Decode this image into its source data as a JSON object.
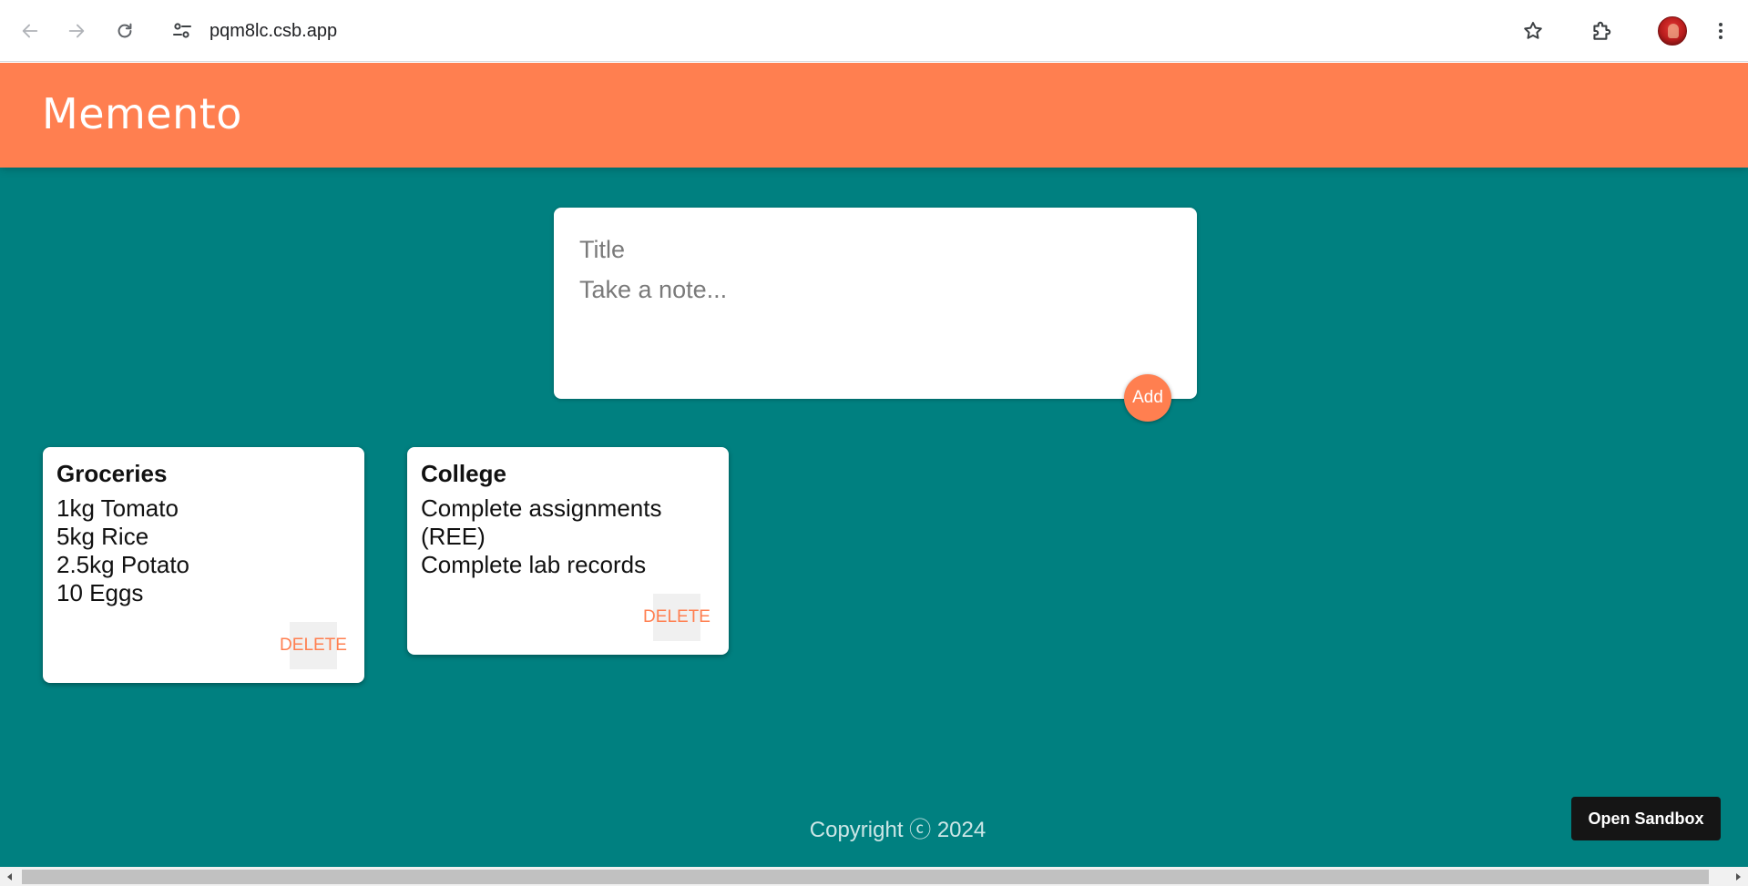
{
  "browser": {
    "url": "pqm8lc.csb.app",
    "icons": {
      "back": "arrow-left-icon",
      "forward": "arrow-right-icon",
      "reload": "reload-icon",
      "site_info": "tune-icon",
      "bookmark": "star-icon",
      "extensions": "puzzle-icon",
      "profile": "avatar",
      "menu": "kebab-menu-icon"
    }
  },
  "app": {
    "title": "Memento",
    "colors": {
      "header": "#ff7f50",
      "background": "#008080",
      "card": "#ffffff",
      "accent": "#ff7f50"
    }
  },
  "create_note": {
    "title_placeholder": "Title",
    "content_placeholder": "Take a note...",
    "add_label": "Add"
  },
  "notes": [
    {
      "title": "Groceries",
      "lines": [
        "1kg Tomato",
        "5kg Rice",
        "2.5kg Potato",
        "10 Eggs"
      ],
      "delete_label": "DELETE"
    },
    {
      "title": "College",
      "lines": [
        "Complete assignments",
        "(REE)",
        "Complete lab records"
      ],
      "delete_label": "DELETE"
    }
  ],
  "footer": {
    "copyright": "Copyright ⓒ 2024"
  },
  "sandbox": {
    "button_label": "Open Sandbox"
  }
}
